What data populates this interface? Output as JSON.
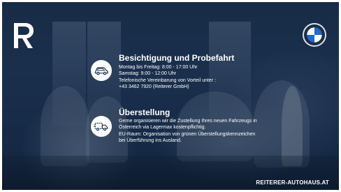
{
  "brand": {
    "logo_letter": "R",
    "url": "REITERER-AUTOHAUS.AT"
  },
  "sections": [
    {
      "icon": "car-icon",
      "title": "Besichtigung und Probefahrt",
      "lines": [
        "Montag bis Freitag:  8:00 - 17:00 Uhr",
        "Samstag: 9:00 - 12:00 Uhr",
        "Telefonische Vereinbarung von Vorteil unter :",
        "+43 3462 7920  (Reiterer GmbH)"
      ]
    },
    {
      "icon": "delivery-truck-icon",
      "title": "Überstellung",
      "lines": [
        "Gerne organisieren wir die Zustellung Ihres neuen Fahrzeugs in",
        "Österreich via Lagermax kostenpflichtig.",
        "EU-Raum: Organisation von grünen Überstellungskennzeichen",
        "bei Überführung ins Ausland."
      ]
    }
  ],
  "colors": {
    "background": "#1d3350",
    "text": "#ffffff",
    "bmw_blue": "#1c69d4"
  }
}
